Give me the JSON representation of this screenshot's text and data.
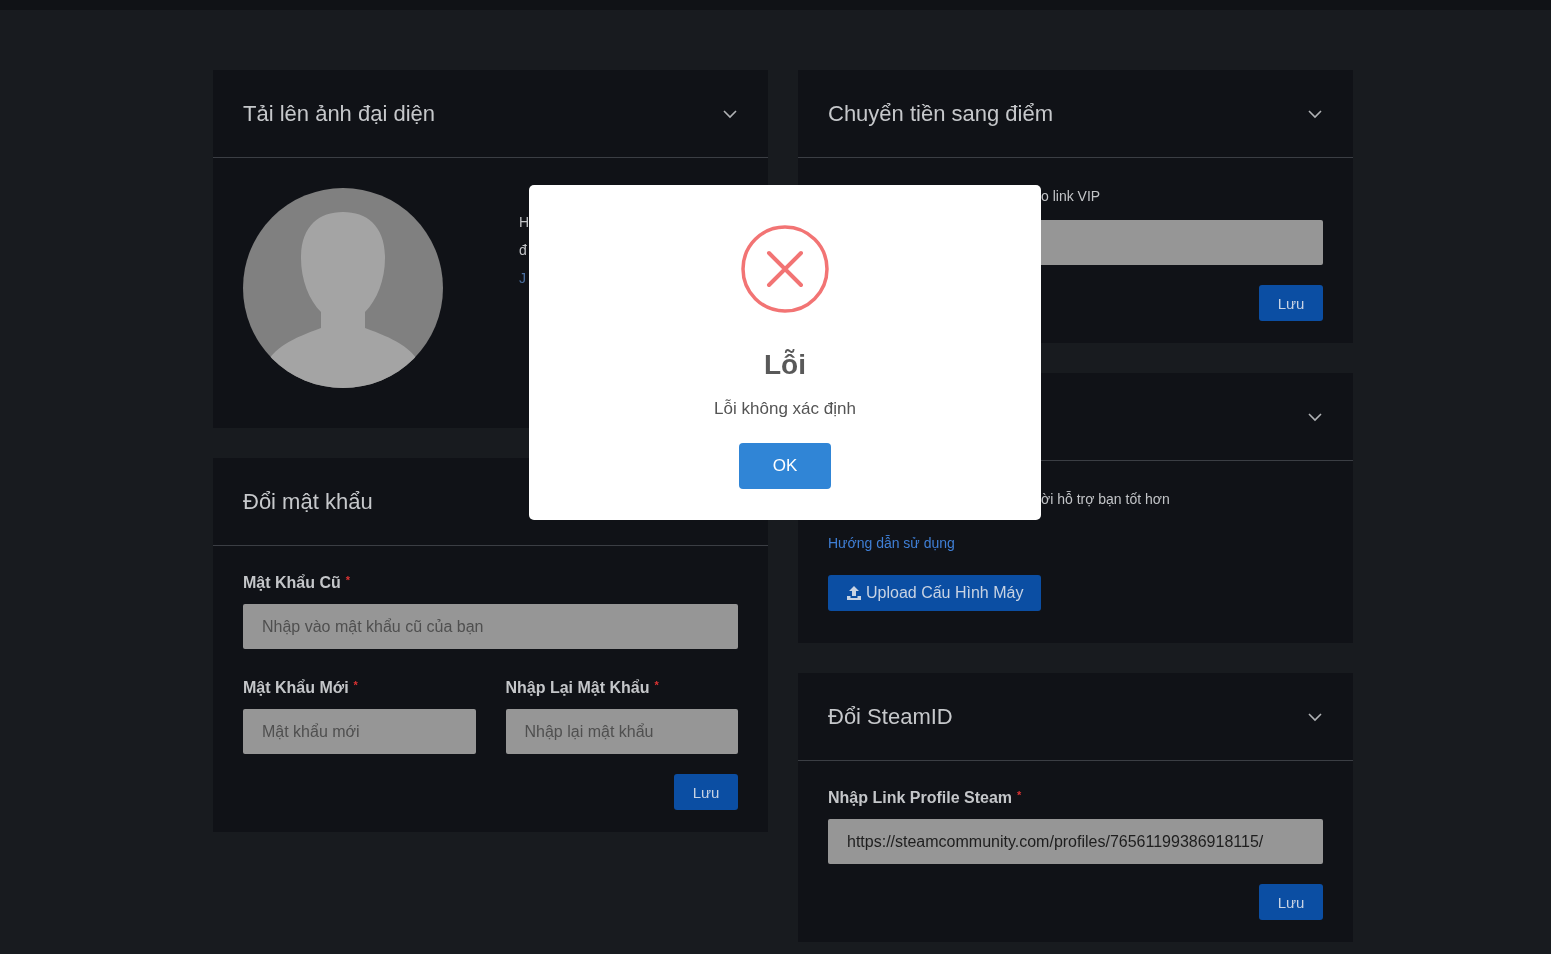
{
  "columns": [
    {
      "cards": [
        {
          "title": "Tải lên ảnh đại diện",
          "expanded": true,
          "items": [
            {
              "kind": "avatar_block",
              "lines": [
                {
                  "kind": "text",
                  "text": "H"
                },
                {
                  "kind": "text",
                  "text": "đ"
                },
                {
                  "kind": "link",
                  "text": "J"
                }
              ]
            }
          ]
        },
        {
          "title": "Đổi mật khẩu",
          "items": [
            {
              "kind": "field",
              "label": "Mật Khẩu Cũ",
              "mark": "*",
              "placeholder": "Nhập vào mật khẩu cũ của bạn"
            },
            {
              "kind": "field_row",
              "fields": [
                {
                  "label": "Mật Khẩu Mới",
                  "mark": "*",
                  "placeholder": "Mật khẩu mới"
                },
                {
                  "label": "Nhập Lại Mật Khẩu",
                  "mark": "*",
                  "placeholder": "Nhập lại mật khẩu"
                }
              ]
            },
            {
              "kind": "save_button",
              "label": "Lưu"
            }
          ]
        }
      ]
    },
    {
      "cards": [
        {
          "title": "Chuyển tiền sang điểm",
          "expanded": true,
          "items": [
            {
              "kind": "cut_text",
              "text": "o link VIP"
            },
            {
              "kind": "field"
            },
            {
              "kind": "save_button",
              "label": "Lưu"
            }
          ]
        },
        {
          "expanded": true,
          "items": [
            {
              "kind": "cut_text",
              "text": "ời hỗ trợ bạn tốt hơn"
            },
            {
              "kind": "link",
              "text": "Hướng dẫn sử dụng"
            },
            {
              "kind": "upload_button",
              "label": "Upload Cấu Hình Máy"
            }
          ]
        },
        {
          "title": "Đổi SteamID",
          "expanded": true,
          "items": [
            {
              "kind": "field",
              "label": "Nhập Link Profile Steam",
              "mark": "*",
              "value": "https://steamcommunity.com/profiles/76561199386918115/"
            },
            {
              "kind": "save_button",
              "label": "Lưu"
            }
          ]
        }
      ]
    }
  ],
  "dialog": {
    "kind": "error",
    "title": "Lỗi",
    "message": "Lỗi không xác định",
    "button": "OK"
  }
}
